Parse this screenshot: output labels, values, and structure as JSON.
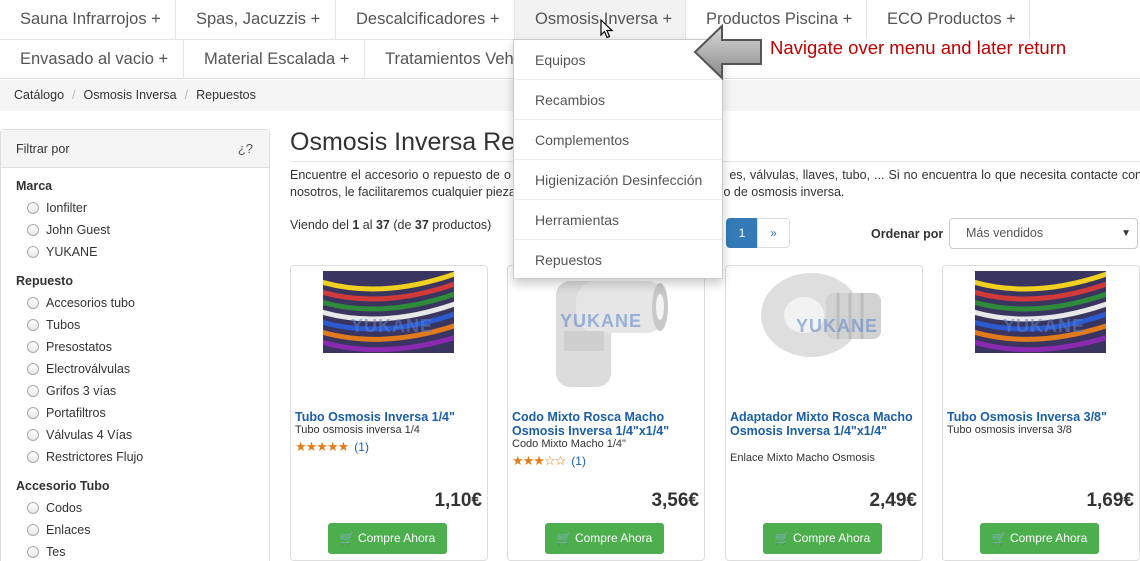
{
  "nav": {
    "row1": [
      "Sauna Infrarrojos +",
      "Spas, Jacuzzis +",
      "Descalcificadores +",
      "Osmosis Inversa +",
      "Productos Piscina +",
      "ECO Productos +"
    ],
    "row2": [
      "Envasado al vacio +",
      "Material Escalada +",
      "Tratamientos Vehi"
    ]
  },
  "dropdown": [
    "Equipos",
    "Recambios",
    "Complementos",
    "Higienización Desinfección",
    "Herramientas",
    "Repuestos"
  ],
  "annotation": "Navigate over menu and later return",
  "breadcrumb": [
    "Catálogo",
    "Osmosis Inversa",
    "Repuestos"
  ],
  "sidebar": {
    "title": "Filtrar por",
    "help": "¿?",
    "groups": [
      {
        "title": "Marca",
        "options": [
          "Ionfilter",
          "John Guest",
          "YUKANE"
        ]
      },
      {
        "title": "Repuesto",
        "options": [
          "Accesorios tubo",
          "Tubos",
          "Presostatos",
          "Electroválvulas",
          "Grifos 3 vías",
          "Portafiltros",
          "Válvulas 4 Vías",
          "Restrictores Flujo"
        ]
      },
      {
        "title": "Accesorio Tubo",
        "options": [
          "Codos",
          "Enlaces",
          "Tes"
        ]
      }
    ]
  },
  "main": {
    "title": "Osmosis Inversa Re",
    "intro": "Encuentre el accesorio o repuesto de o                                                      es, válvulas, llaves, tubo, ... Si no encuentra lo que necesita contacte con nosotros, le facilitaremos cualquier pieza d                                                    uipo de osmosis inversa.",
    "viewing": {
      "prefix": "Viendo del ",
      "from": "1",
      "mid1": " al ",
      "to": "37",
      "mid2": " (de ",
      "total": "37",
      "suffix": " productos)"
    },
    "pager": {
      "current": "1",
      "next": "»"
    },
    "sort_label": "Ordenar por",
    "sort_value": "Más vendidos"
  },
  "products": [
    {
      "name": "Tubo Osmosis Inversa 1/4\"",
      "desc": "Tubo osmosis inversa 1/4",
      "stars": "★★★★★",
      "rating": 5,
      "reviews": "(1)",
      "price": "1,10€",
      "buy": "Compre Ahora",
      "watermark": "YUKANE"
    },
    {
      "name": "Codo Mixto Rosca Macho Osmosis Inversa 1/4\"x1/4\"",
      "desc": "Codo Mixto Macho 1/4\"",
      "stars": "★★★☆☆",
      "rating": 3,
      "reviews": "(1)",
      "price": "3,56€",
      "buy": "Compre Ahora",
      "watermark": "YUKANE"
    },
    {
      "name": "Adaptador Mixto Rosca Macho Osmosis Inversa 1/4\"x1/4\"",
      "desc": "Enlace Mixto Macho Osmosis",
      "price": "2,49€",
      "buy": "Compre Ahora",
      "watermark": "YUKANE"
    },
    {
      "name": "Tubo Osmosis Inversa 3/8\"",
      "desc": "Tubo osmosis inversa 3/8",
      "price": "1,69€",
      "buy": "Compre Ahora",
      "watermark": "YUKANE"
    }
  ],
  "colors": {
    "link": "#1a5fa8",
    "buy_button": "#4cae4c",
    "pager_active": "#337ab7",
    "stars": "#e27c1a",
    "annotation": "#c00000"
  }
}
